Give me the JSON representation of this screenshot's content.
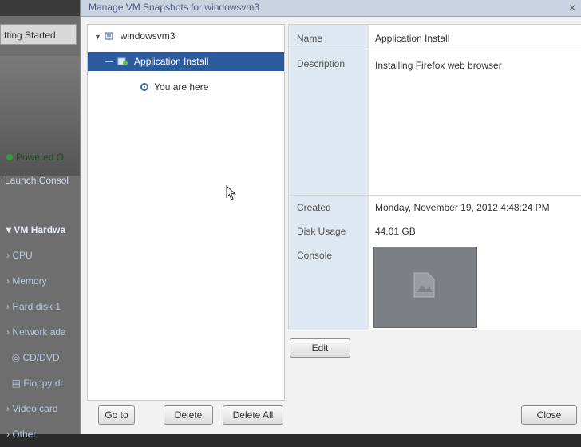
{
  "background": {
    "tab_label": "tting Started",
    "status_label": "Powered O",
    "launch_console": "Launch Consol",
    "vm_hardware_header": "VM Hardwa",
    "hardware_items": [
      "CPU",
      "Memory",
      "Hard disk 1",
      "Network ada",
      "CD/DVD",
      "Floppy dr",
      "Video card",
      "Other"
    ]
  },
  "dialog": {
    "title": "Manage VM Snapshots for windowsvm3",
    "tree": {
      "root_label": "windowsvm3",
      "selected_label": "Application Install",
      "here_label": "You are here"
    },
    "details": {
      "name_label": "Name",
      "name_value": "Application Install",
      "description_label": "Description",
      "description_value": "Installing Firefox web browser",
      "created_label": "Created",
      "created_value": "Monday, November 19, 2012 4:48:24 PM",
      "disk_usage_label": "Disk Usage",
      "disk_usage_value": "44.01 GB",
      "console_label": "Console"
    },
    "buttons": {
      "edit": "Edit",
      "goto": "Go to",
      "delete": "Delete",
      "delete_all": "Delete All",
      "close": "Close"
    }
  },
  "colors": {
    "selection": "#2e5a9e",
    "label_column": "#dfe7f2"
  }
}
